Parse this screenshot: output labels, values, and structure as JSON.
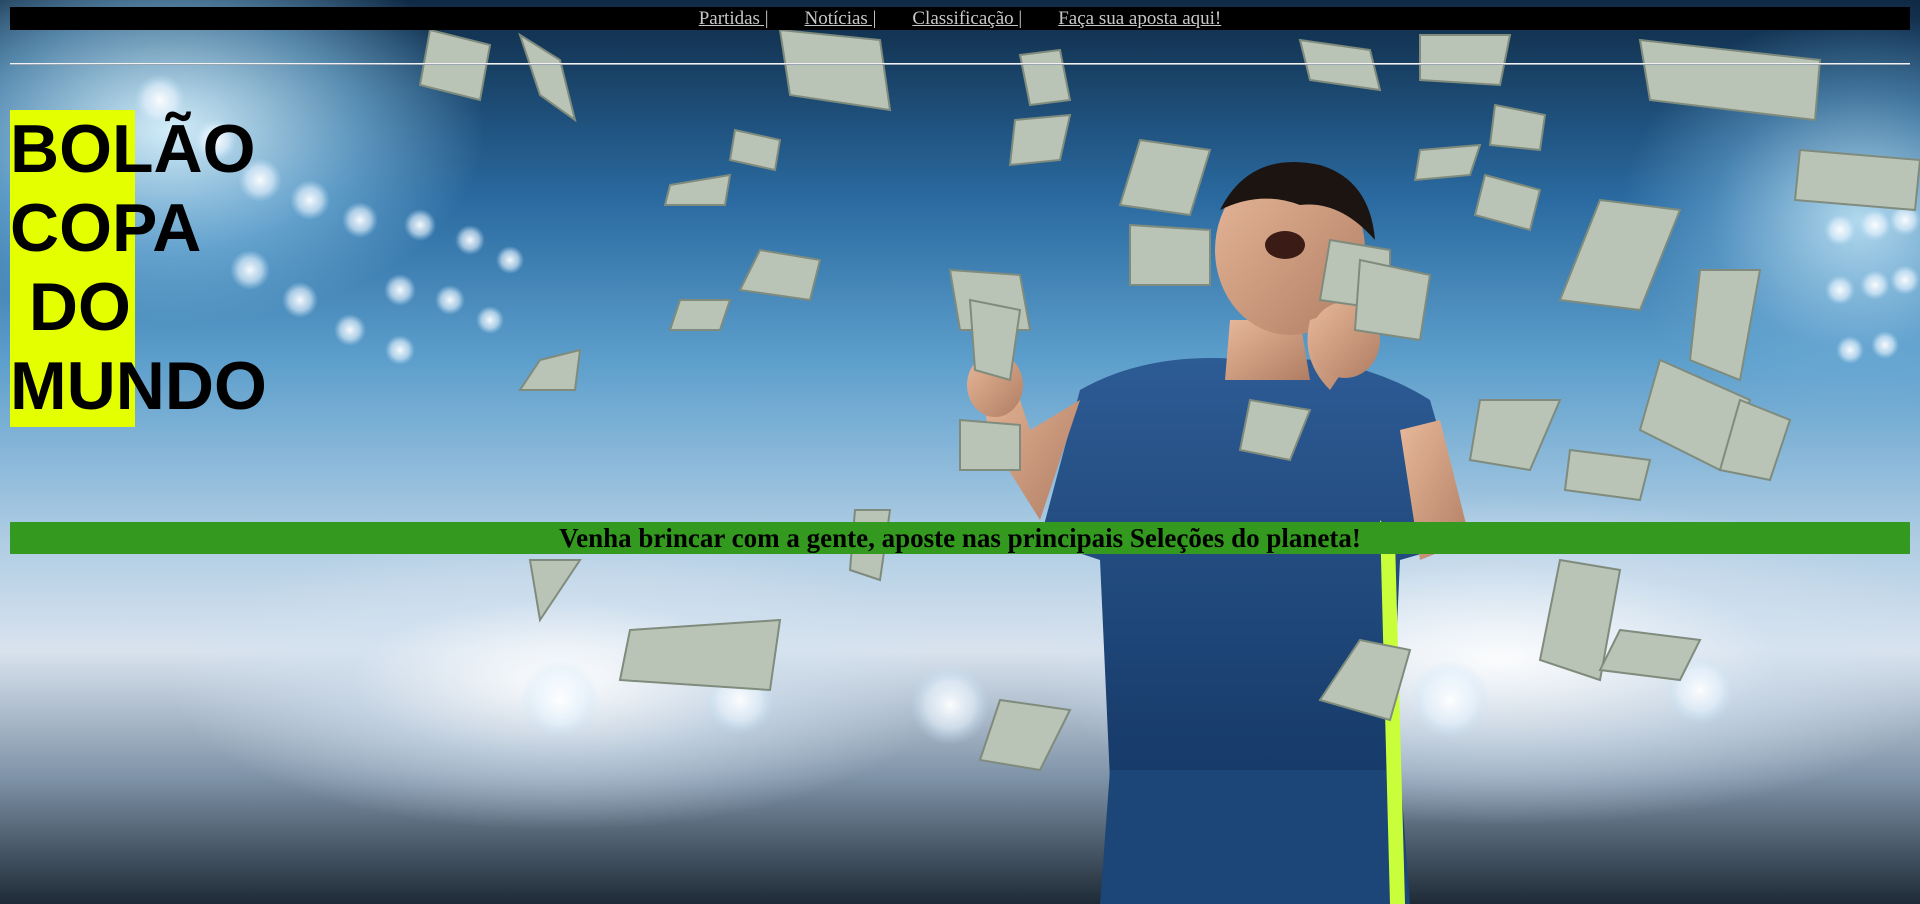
{
  "nav": {
    "items": [
      {
        "label": "Partidas |"
      },
      {
        "label": "Notícias |"
      },
      {
        "label": "Classificação |"
      },
      {
        "label": "Faça sua aposta aqui!"
      }
    ]
  },
  "hero": {
    "title_lines": [
      "BOLÃO",
      "COPA",
      " DO",
      "MUNDO"
    ],
    "highlight_color": "#e4ff00"
  },
  "banner": {
    "text": "Venha brincar com a gente, aposte nas principais Seleções do planeta!",
    "color": "#339a1f"
  },
  "colors": {
    "nav_background": "#000000",
    "nav_link": "#c8c8c8"
  }
}
